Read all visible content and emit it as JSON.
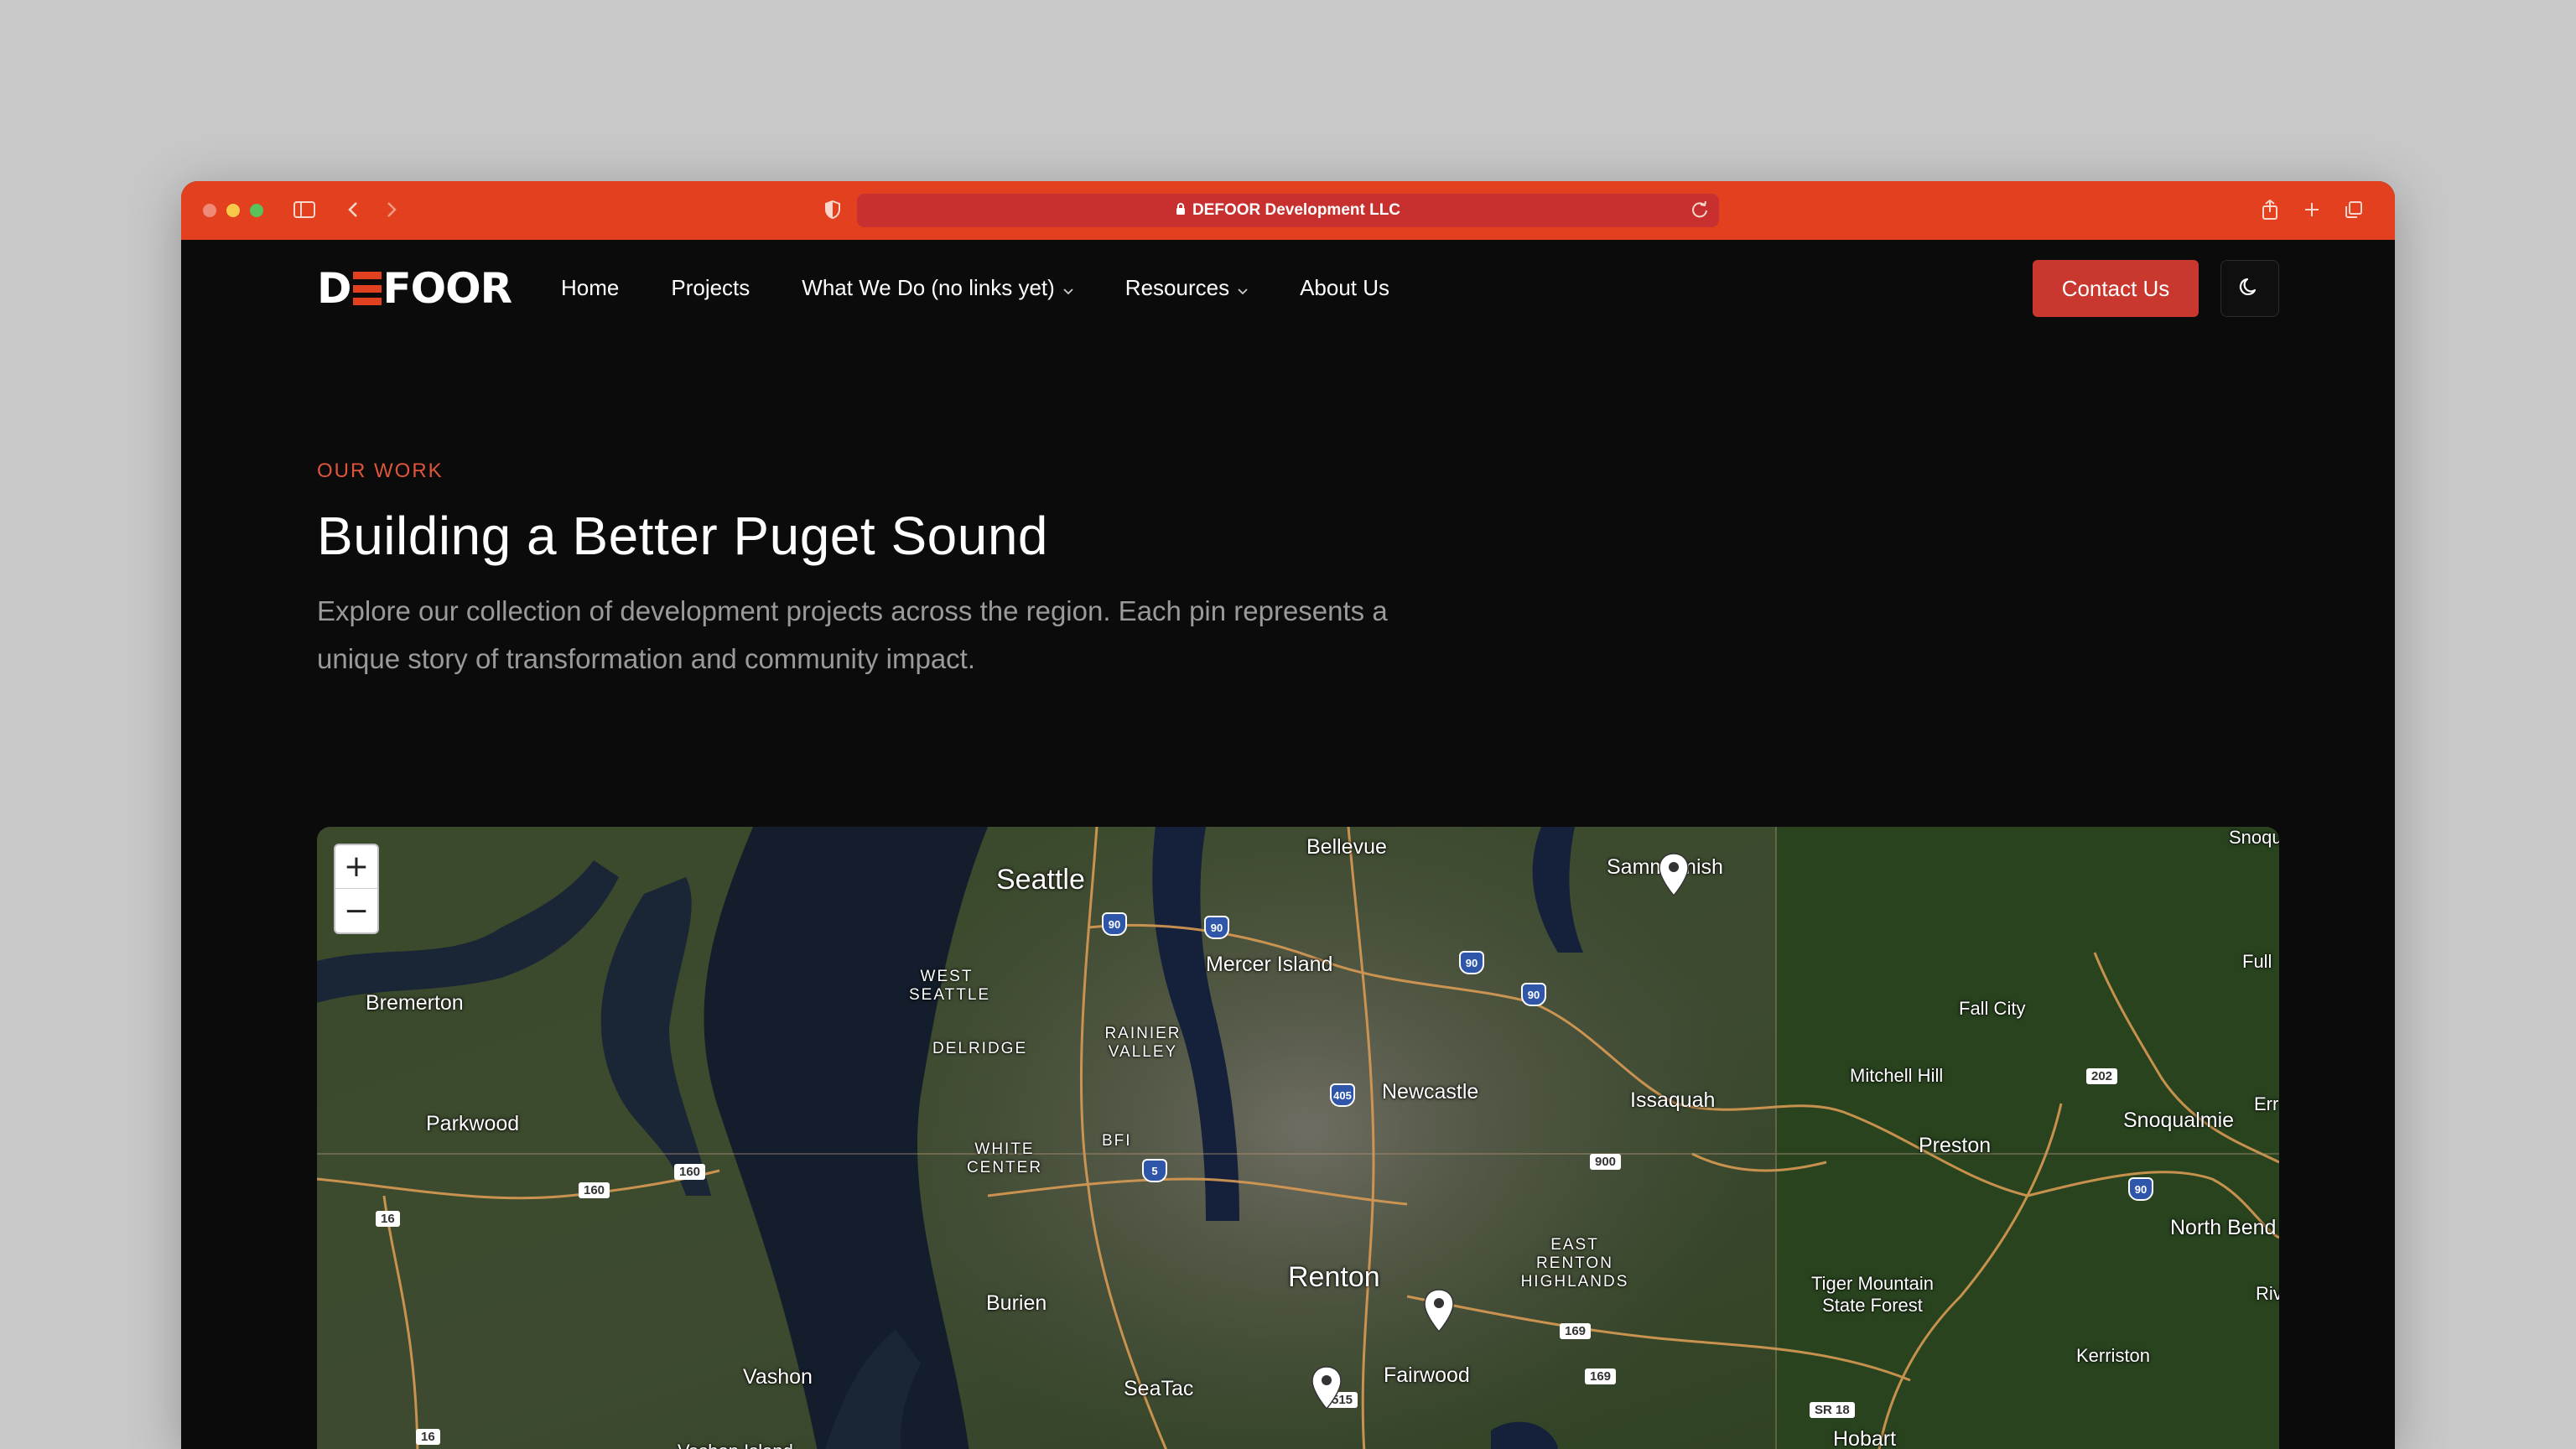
{
  "browser": {
    "url_text": "DEFOOR Development LLC",
    "accent": "#e2401e"
  },
  "header": {
    "logo_text_left": "D",
    "logo_text_right": "FOOR",
    "nav": [
      {
        "label": "Home"
      },
      {
        "label": "Projects"
      },
      {
        "label": "What We Do (no links yet)",
        "dropdown": true
      },
      {
        "label": "Resources",
        "dropdown": true
      },
      {
        "label": "About Us"
      }
    ],
    "contact_label": "Contact Us",
    "theme_icon": "moon-icon"
  },
  "hero": {
    "eyebrow": "OUR WORK",
    "title": "Building a Better Puget Sound",
    "subtitle": "Explore our collection of development projects across the region. Each pin represents a unique story of transformation and community impact."
  },
  "map": {
    "zoom_in": "+",
    "zoom_out": "−",
    "places": [
      "Seattle",
      "Bellevue",
      "Sammamish",
      "Mercer Island",
      "Bremerton",
      "WEST SEATTLE",
      "DELRIDGE",
      "RAINIER VALLEY",
      "Newcastle",
      "Issaquah",
      "Fall City",
      "Mitchell Hill",
      "Snoqualmie",
      "Preston",
      "Parkwood",
      "WHITE CENTER",
      "BFI",
      "EAST RENTON HIGHLANDS",
      "Renton",
      "Burien",
      "Tiger Mountain State Forest",
      "North Bend",
      "Kerriston",
      "Fairwood",
      "SeaTac",
      "Vashon",
      "Vashon Island",
      "Hobart",
      "Snoqu",
      "Full",
      "Err",
      "Riv"
    ],
    "route_labels": [
      "90",
      "90",
      "90",
      "90",
      "90",
      "405",
      "5",
      "160",
      "160",
      "16",
      "16",
      "900",
      "169",
      "169",
      "202",
      "SR 18",
      "515"
    ],
    "pins": 3
  }
}
